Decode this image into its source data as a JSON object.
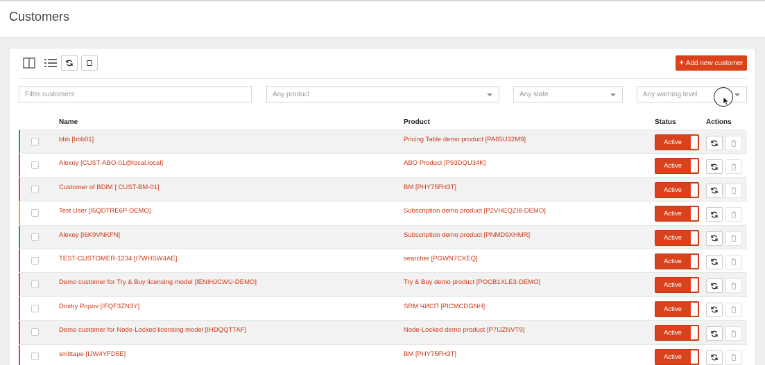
{
  "page": {
    "title": "Customers"
  },
  "toolbar": {
    "add_label": "Add new customer"
  },
  "filters": {
    "customers_placeholder": "Filter customers",
    "product": "Any product",
    "state": "Any state",
    "warning": "Any warning level"
  },
  "table": {
    "headers": {
      "name": "Name",
      "product": "Product",
      "status": "Status",
      "actions": "Actions"
    },
    "rows": [
      {
        "name": "bbb [bbb01]",
        "product": "Pricing Table demo product [PA65U32M9]",
        "status": "Active",
        "indicator": "#1a9e6e"
      },
      {
        "name": "Alexey [CUST-ABO-01@local.local]",
        "product": "ABO Product [P93DQU34K]",
        "status": "Active",
        "indicator": "#d9423a"
      },
      {
        "name": "Customer of BDiM [ CUST-BM-01]",
        "product": "BM [PHY75FH3T]",
        "status": "Active",
        "indicator": "#d9423a"
      },
      {
        "name": "Test User [I5QDTRE6P-DEMO]",
        "product": "Subscription demo product [P2VHEQZI8-DEMO]",
        "status": "Active",
        "indicator": "#f0a030"
      },
      {
        "name": "Alexey [I6K9VNKFN]",
        "product": "Subscription demo product [PNMD9XHMR]",
        "status": "Active",
        "indicator": "#1a9e6e"
      },
      {
        "name": "TEST-CUSTOMER-1234 [I7WHSW4AE]",
        "product": "searcher [PGWN7CXEQ]",
        "status": "Active",
        "indicator": "#d9423a"
      },
      {
        "name": "Demo customer for Try & Buy licensing model [IENIHJCWU-DEMO]",
        "product": "Try & Buy demo product [POCB1XLE3-DEMO]",
        "status": "Active",
        "indicator": "#d9423a"
      },
      {
        "name": "Dmitry Popov [IFQF3ZN3Y]",
        "product": "SRM ЧИСП [PICMCDGNH]",
        "status": "Active",
        "indicator": "#d9423a"
      },
      {
        "name": "Demo customer for Node-Locked licensing model [IHDQQTTAF]",
        "product": "Node-Locked demo product [P7IJZNVT9]",
        "status": "Active",
        "indicator": "#d9423a"
      },
      {
        "name": "smittape [IJW4YFD5E]",
        "product": "BM [PHY75FH3T]",
        "status": "Active",
        "indicator": "#d9423a"
      }
    ]
  },
  "colors": {
    "accent": "#d9421a",
    "link": "#c9391a"
  },
  "icons": [
    "split-view-icon",
    "list-view-icon",
    "refresh-icon",
    "square-icon",
    "plus-icon",
    "chevron-down-icon",
    "trash-icon",
    "cursor-icon"
  ]
}
